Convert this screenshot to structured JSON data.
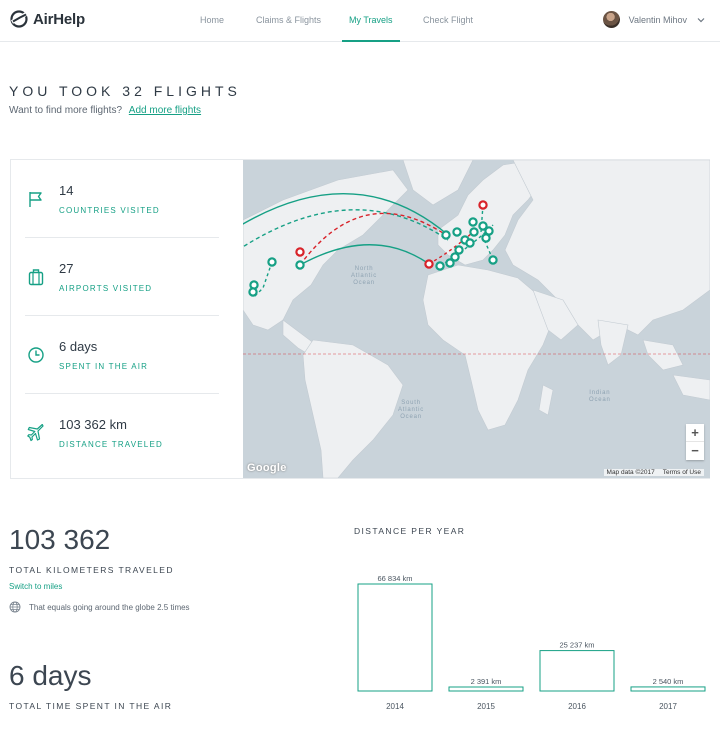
{
  "header": {
    "brand": "AirHelp",
    "nav": [
      {
        "label": "Home",
        "active": false
      },
      {
        "label": "Claims & Flights",
        "active": false
      },
      {
        "label": "My Travels",
        "active": true
      },
      {
        "label": "Check Flight",
        "active": false
      }
    ],
    "user_name": "Valentin Mihov"
  },
  "title": "YOU TOOK 32 FLIGHTS",
  "subtitle": {
    "text": "Want to find more flights?",
    "link": "Add more flights"
  },
  "stats": [
    {
      "value": "14",
      "label": "COUNTRIES VISITED",
      "icon": "flag-icon"
    },
    {
      "value": "27",
      "label": "AIRPORTS VISITED",
      "icon": "luggage-icon"
    },
    {
      "value": "6 days",
      "label": "SPENT IN THE AIR",
      "icon": "clock-icon"
    },
    {
      "value": "103 362 km",
      "label": "DISTANCE TRAVELED",
      "icon": "plane-icon"
    }
  ],
  "map": {
    "labels": [
      {
        "text": "North\nAtlantic\nOcean"
      },
      {
        "text": "South\nAtlantic\nOcean"
      },
      {
        "text": "Indian\nOcean"
      }
    ],
    "zoom_in": "+",
    "zoom_out": "−",
    "google": "Google",
    "map_data": "Map data ©2017",
    "terms": "Terms of Use",
    "colors": {
      "route": "#16a085",
      "highlight": "#d8232a",
      "land": "#eef0f2",
      "water": "#c9d3da"
    }
  },
  "distance": {
    "value": "103 362",
    "label": "TOTAL KILOMETERS TRAVELED",
    "switch": "Switch to miles",
    "globe_text": "That equals going around the globe 2.5 times"
  },
  "air_time": {
    "value": "6 days",
    "label": "TOTAL TIME SPENT IN THE AIR"
  },
  "chart_title": "DISTANCE PER YEAR",
  "chart_data": {
    "type": "bar",
    "title": "DISTANCE PER YEAR",
    "categories": [
      "2014",
      "2015",
      "2016",
      "2017"
    ],
    "values": [
      66834,
      2391,
      25237,
      2540
    ],
    "value_labels": [
      "66 834 km",
      "2 391 km",
      "25 237 km",
      "2 540 km"
    ],
    "unit": "km",
    "color": "#16a085"
  }
}
